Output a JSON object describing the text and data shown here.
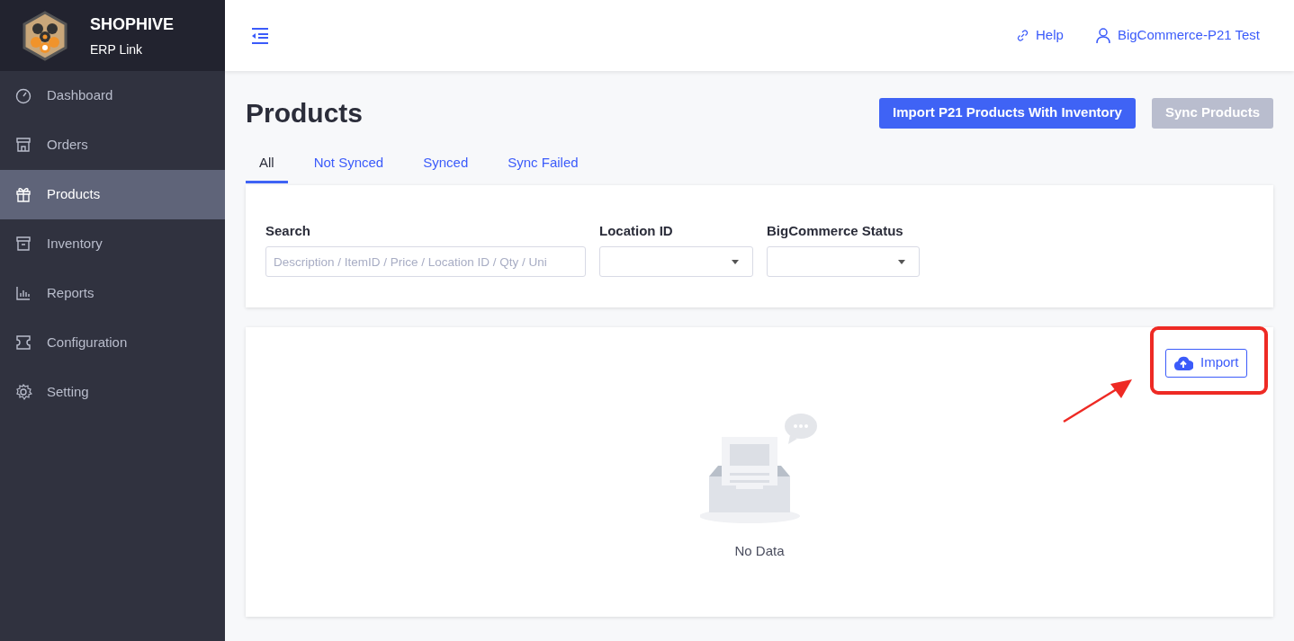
{
  "brand": {
    "name": "SHOPHIVE",
    "subtitle": "ERP Link"
  },
  "sidebar": {
    "items": [
      {
        "label": "Dashboard",
        "selected": false
      },
      {
        "label": "Orders",
        "selected": false
      },
      {
        "label": "Products",
        "selected": true
      },
      {
        "label": "Inventory",
        "selected": false
      },
      {
        "label": "Reports",
        "selected": false
      },
      {
        "label": "Configuration",
        "selected": false
      },
      {
        "label": "Setting",
        "selected": false
      }
    ]
  },
  "header": {
    "help": "Help",
    "user": "BigCommerce-P21 Test"
  },
  "page": {
    "title": "Products",
    "buttons": [
      {
        "label": "Import P21 Products With Inventory",
        "disabled": false
      },
      {
        "label": "Sync Products",
        "disabled": true
      }
    ]
  },
  "tabs": [
    {
      "label": "All",
      "selected": true
    },
    {
      "label": "Not Synced",
      "selected": false
    },
    {
      "label": "Synced",
      "selected": false
    },
    {
      "label": "Sync Failed",
      "selected": false
    }
  ],
  "filters": {
    "search": {
      "label": "Search",
      "placeholder": "Description / ItemID / Price / Location ID / Qty / Uni"
    },
    "location": {
      "label": "Location ID"
    },
    "status": {
      "label": "BigCommerce Status"
    }
  },
  "results": {
    "import_button": "Import",
    "empty_text": "No Data",
    "highlighted": true
  }
}
